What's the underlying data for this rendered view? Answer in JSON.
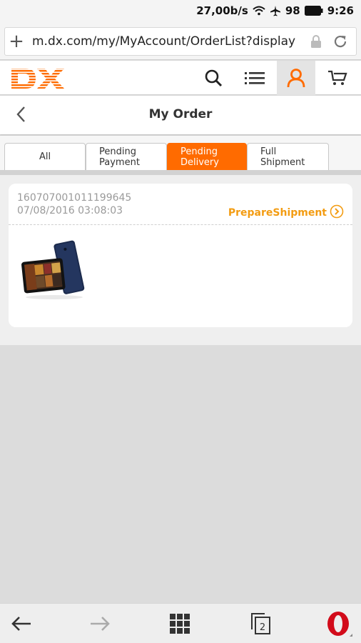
{
  "status_bar": {
    "net_speed": "27,00b/s",
    "battery": "98",
    "time": "9:26"
  },
  "browser": {
    "url": "m.dx.com/my/MyAccount/OrderList?display",
    "tab_count": "2"
  },
  "site": {
    "logo_text": "DX",
    "brand_color": "#ff6b00"
  },
  "page": {
    "title": "My Order"
  },
  "tabs": [
    {
      "label": "All"
    },
    {
      "label": "Pending\nPayment"
    },
    {
      "label": "Pending\nDelivery"
    },
    {
      "label": "Full\nShipment"
    }
  ],
  "order": {
    "number": "160707001011199645",
    "date": "07/08/2016 03:08:03",
    "status": "PrepareShipment",
    "status_color": "#f39c12"
  }
}
